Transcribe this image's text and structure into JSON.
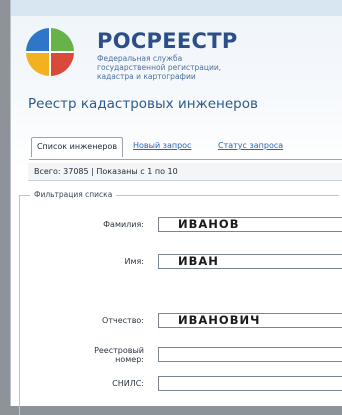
{
  "header": {
    "brand": "РОСРЕЕСТР",
    "agency_lines": [
      "Федеральная служба",
      "государственной регистрации,",
      "кадастра и картографии"
    ],
    "logo_icon": "rosreestr-emblem-icon"
  },
  "page_title": "Реестр кадастровых инженеров",
  "tabs": [
    {
      "label": "Список инженеров",
      "active": true
    },
    {
      "label": "Новый запрос",
      "active": false
    },
    {
      "label": "Статус запроса",
      "active": false
    }
  ],
  "summary": "Всего: 37085 | Показаны с 1 по 10",
  "filter": {
    "legend": "Фильтрация списка",
    "fields": [
      {
        "label": "Фамилия:",
        "value": "ИВАНОВ"
      },
      {
        "label": "Имя:",
        "value": "ИВАН"
      },
      {
        "label": "Отчество:",
        "value": "ИВАНОВИЧ"
      },
      {
        "label_lines": [
          "Реестровый",
          "номер:"
        ],
        "value": ""
      },
      {
        "label": "СНИЛС:",
        "value": ""
      }
    ]
  },
  "colors": {
    "brand": "#2c4f8a",
    "link": "#2a63b3",
    "page_bg": "#8e9399"
  }
}
